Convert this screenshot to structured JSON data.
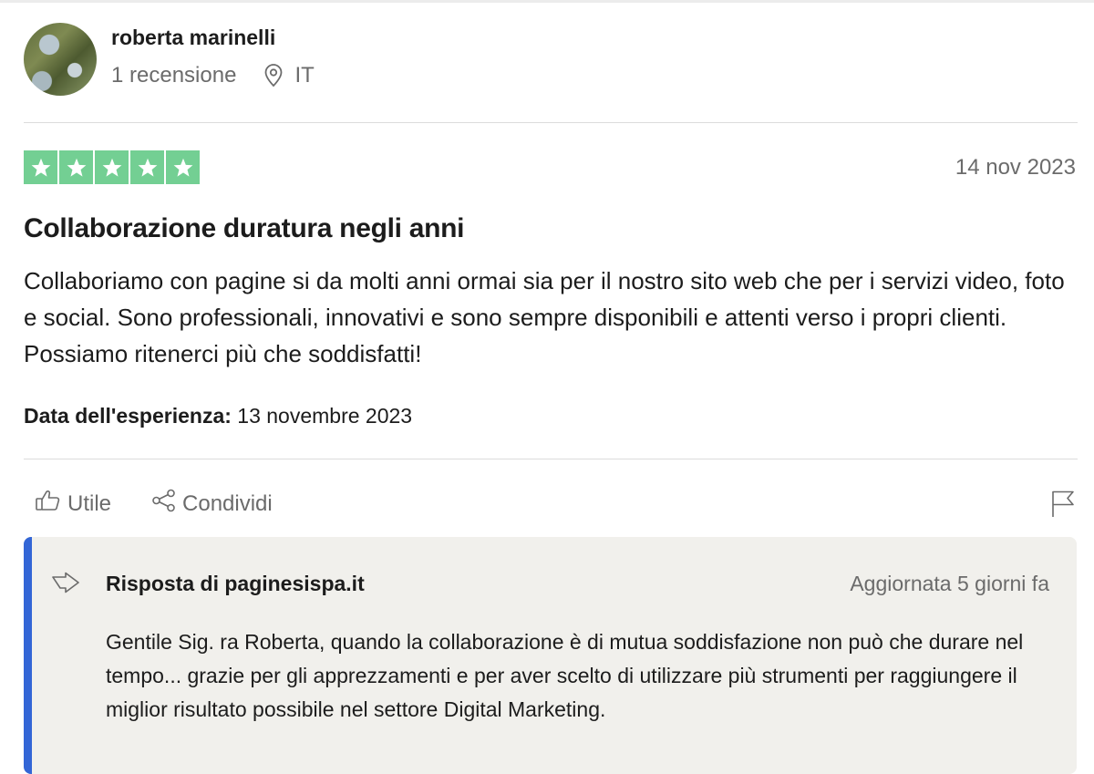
{
  "reviewer": {
    "name": "roberta marinelli",
    "reviews_count": "1 recensione",
    "country": "IT",
    "avatar_icon": "avatar-photo"
  },
  "review": {
    "rating": 5,
    "rating_max": 5,
    "star_color": "#73cf93",
    "date": "14 nov 2023",
    "title": "Collaborazione duratura negli anni",
    "body": "Collaboriamo con pagine si da molti anni ormai sia per il nostro sito web che per i servizi video, foto e social. Sono professionali, innovativi e sono sempre disponibili e attenti verso i propri clienti. Possiamo ritenerci più che soddisfatti!",
    "experience_label": "Data dell'esperienza:",
    "experience_date": "13 novembre 2023"
  },
  "actions": {
    "useful_label": "Utile",
    "useful_icon": "thumbs-up-icon",
    "share_label": "Condividi",
    "share_icon": "share-icon",
    "flag_icon": "flag-icon"
  },
  "reply": {
    "title": "Risposta di paginesispa.it",
    "updated": "Aggiornata 5 giorni fa",
    "body": "Gentile Sig. ra Roberta, quando la collaborazione è di mutua soddisfazione non può che durare nel tempo... grazie per gli apprezzamenti e per aver scelto di utilizzare più strumenti per raggiungere il miglior risultato possibile nel settore Digital Marketing.",
    "accent_color": "#3366d6",
    "icon": "reply-arrow-icon"
  }
}
